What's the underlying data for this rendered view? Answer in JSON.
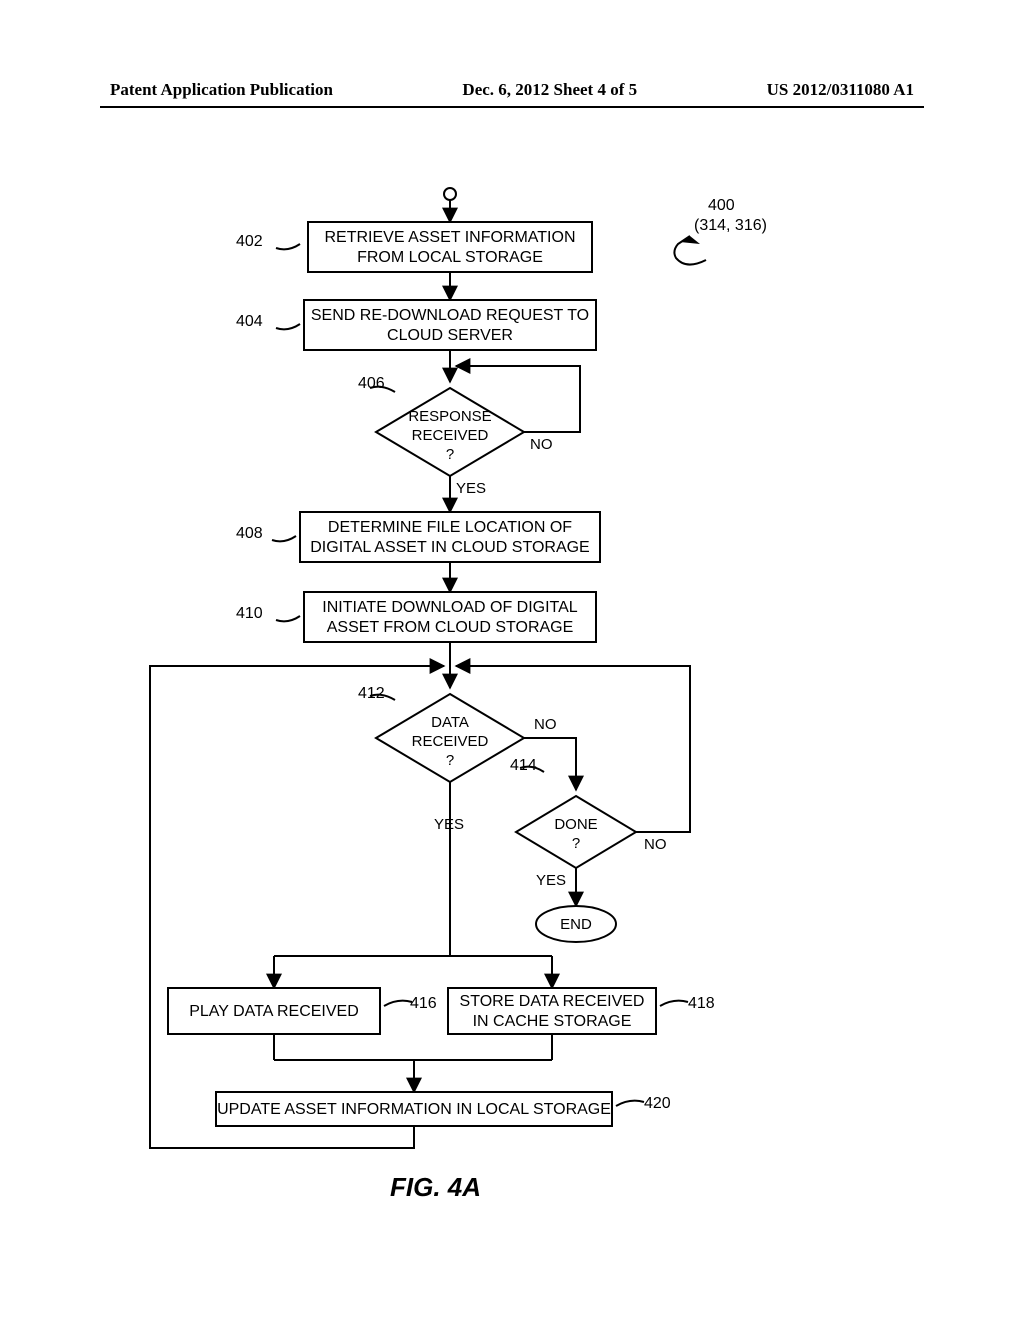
{
  "header": {
    "left": "Patent Application Publication",
    "center": "Dec. 6, 2012   Sheet 4 of 5",
    "right": "US 2012/0311080 A1"
  },
  "refnums": {
    "n400": "400",
    "n400sub": "(314, 316)",
    "n402": "402",
    "n404": "404",
    "n406": "406",
    "n408": "408",
    "n410": "410",
    "n412": "412",
    "n414": "414",
    "n416": "416",
    "n418": "418",
    "n420": "420"
  },
  "boxes": {
    "b402": "RETRIEVE ASSET INFORMATION\nFROM LOCAL STORAGE",
    "b404": "SEND RE-DOWNLOAD REQUEST TO\nCLOUD SERVER",
    "b408": "DETERMINE FILE LOCATION OF\nDIGITAL ASSET IN CLOUD STORAGE",
    "b410": "INITIATE DOWNLOAD OF DIGITAL\nASSET FROM CLOUD STORAGE",
    "b416": "PLAY DATA RECEIVED",
    "b418": "STORE DATA RECEIVED\nIN CACHE STORAGE",
    "b420": "UPDATE ASSET INFORMATION IN LOCAL STORAGE"
  },
  "decisions": {
    "d406": "RESPONSE\nRECEIVED\n?",
    "d412": "DATA\nRECEIVED\n?",
    "d414": "DONE\n?"
  },
  "branch": {
    "yes": "YES",
    "no": "NO"
  },
  "terminal": {
    "end": "END"
  },
  "figure": "FIG. 4A"
}
